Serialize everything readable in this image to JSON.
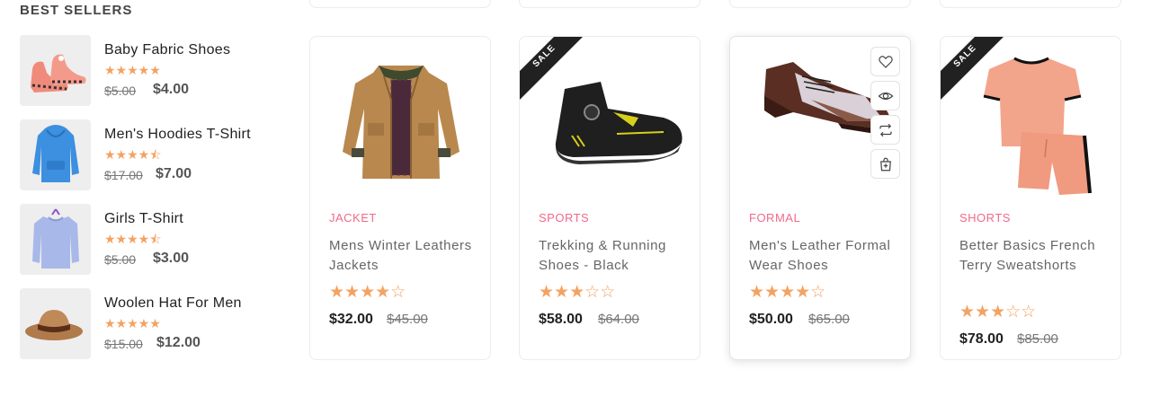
{
  "best_sellers": {
    "title": "BEST SELLERS",
    "items": [
      {
        "name": "Baby Fabric Shoes",
        "stars": "★★★★★",
        "rating": 5,
        "old_price": "$5.00",
        "price": "$4.00",
        "icon": "baby-shoes-icon"
      },
      {
        "name": "Men's Hoodies T-Shirt",
        "stars": "★★★★⯪",
        "rating": 4.5,
        "old_price": "$17.00",
        "price": "$7.00",
        "icon": "hoodie-icon"
      },
      {
        "name": "Girls T-Shirt",
        "stars": "★★★★⯪",
        "rating": 4.5,
        "old_price": "$5.00",
        "price": "$3.00",
        "icon": "sweatshirt-icon"
      },
      {
        "name": "Woolen Hat For Men",
        "stars": "★★★★★",
        "rating": 5,
        "old_price": "$15.00",
        "price": "$12.00",
        "icon": "hat-icon"
      }
    ]
  },
  "products": [
    {
      "category": "JACKET",
      "name": "Mens Winter Leathers Jackets",
      "stars": "★★★★☆",
      "rating": 4,
      "price": "$32.00",
      "old_price": "$45.00",
      "sale": false,
      "sale_label": "",
      "icon": "jacket-icon"
    },
    {
      "category": "SPORTS",
      "name": "Trekking & Running Shoes - Black",
      "stars": "★★★☆☆",
      "rating": 3,
      "price": "$58.00",
      "old_price": "$64.00",
      "sale": true,
      "sale_label": "SALE",
      "icon": "running-shoe-icon"
    },
    {
      "category": "FORMAL",
      "name": "Men's Leather Formal Wear Shoes",
      "stars": "★★★★☆",
      "rating": 4,
      "price": "$50.00",
      "old_price": "$65.00",
      "sale": false,
      "sale_label": "",
      "icon": "formal-shoe-icon"
    },
    {
      "category": "SHORTS",
      "name": "Better Basics French Terry Sweatshorts",
      "stars": "★★★☆☆",
      "rating": 3,
      "price": "$78.00",
      "old_price": "$85.00",
      "sale": true,
      "sale_label": "SALE",
      "icon": "tshirt-shorts-icon"
    }
  ],
  "card_actions": [
    "heart-icon",
    "eye-icon",
    "compare-icon",
    "add-to-cart-icon"
  ],
  "colors": {
    "accent": "#f06a8a",
    "star": "#f4a261",
    "ribbon": "#212121"
  }
}
